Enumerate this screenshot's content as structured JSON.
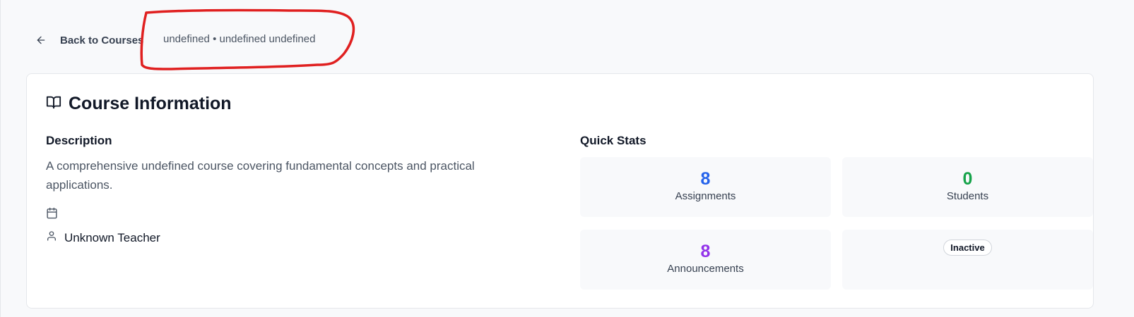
{
  "header": {
    "back_label": "Back to Courses",
    "subtitle": "undefined • undefined undefined"
  },
  "course_info": {
    "title": "Course Information",
    "description_heading": "Description",
    "description": "A comprehensive undefined course covering fundamental concepts and practical applications.",
    "teacher": "Unknown Teacher"
  },
  "quick_stats": {
    "heading": "Quick Stats",
    "assignments": {
      "value": "8",
      "label": "Assignments"
    },
    "students": {
      "value": "0",
      "label": "Students"
    },
    "announcements": {
      "value": "8",
      "label": "Announcements"
    },
    "status": "Inactive"
  },
  "colors": {
    "assignments": "#2563eb",
    "students": "#16a34a",
    "announcements": "#9333ea",
    "annotation": "#e02020"
  },
  "icons": {
    "back": "arrow-left-icon",
    "course": "book-open-icon",
    "date": "calendar-icon",
    "teacher": "user-icon"
  }
}
